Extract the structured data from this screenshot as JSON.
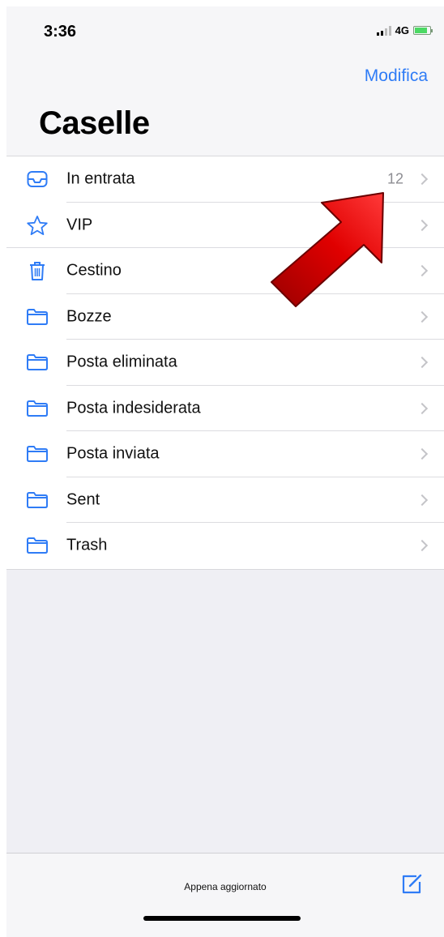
{
  "status_bar": {
    "time": "3:36",
    "network": "4G",
    "battery_level": 0.85
  },
  "header": {
    "edit_label": "Modifica",
    "title": "Caselle"
  },
  "mailboxes": [
    {
      "label": "In entrata",
      "count": "12",
      "icon": "inbox-icon"
    },
    {
      "label": "VIP",
      "count": "",
      "icon": "star-icon"
    },
    {
      "label": "Cestino",
      "count": "",
      "icon": "trash-icon"
    },
    {
      "label": "Bozze",
      "count": "",
      "icon": "folder-icon"
    },
    {
      "label": "Posta eliminata",
      "count": "",
      "icon": "folder-icon"
    },
    {
      "label": "Posta indesiderata",
      "count": "",
      "icon": "folder-icon"
    },
    {
      "label": "Posta inviata",
      "count": "",
      "icon": "folder-icon"
    },
    {
      "label": "Sent",
      "count": "",
      "icon": "folder-icon"
    },
    {
      "label": "Trash",
      "count": "",
      "icon": "folder-icon"
    }
  ],
  "toolbar": {
    "status_text": "Appena aggiornato",
    "compose_icon": "compose-icon"
  },
  "colors": {
    "accent": "#2f7cf6",
    "annotation_arrow": "#d40000"
  }
}
